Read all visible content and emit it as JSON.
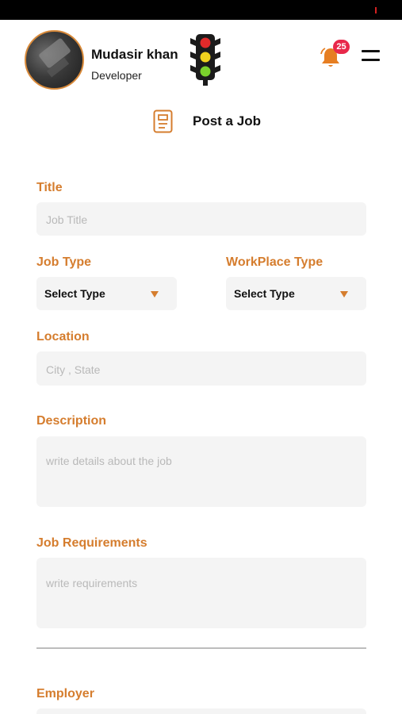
{
  "header": {
    "user_name": "Mudasir khan",
    "user_role": "Developer",
    "notification_count": "25"
  },
  "page": {
    "title": "Post a Job"
  },
  "form": {
    "title": {
      "label": "Title",
      "placeholder": "Job Title"
    },
    "job_type": {
      "label": "Job Type",
      "value": "Select Type"
    },
    "workplace_type": {
      "label": "WorkPlace Type",
      "value": "Select Type"
    },
    "location": {
      "label": "Location",
      "placeholder": "City , State"
    },
    "description": {
      "label": "Description",
      "placeholder": "write details about the job"
    },
    "requirements": {
      "label": "Job Requirements",
      "placeholder": "write requirements"
    },
    "employer": {
      "label": "Employer"
    }
  },
  "colors": {
    "accent": "#d57d2e",
    "badge": "#e8284a",
    "field_bg": "#f4f4f4"
  },
  "icons": [
    "traffic-light-icon",
    "bell-icon",
    "menu-icon",
    "document-icon",
    "caret-down-icon"
  ]
}
